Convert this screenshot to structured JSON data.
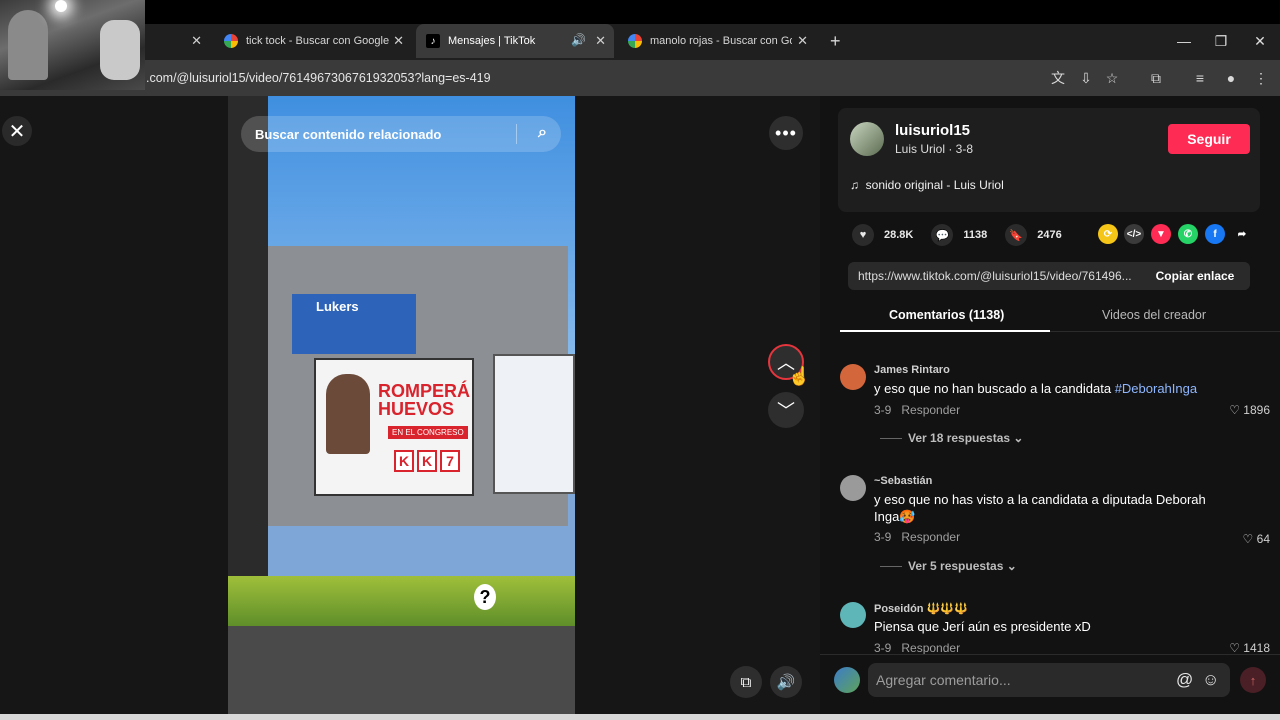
{
  "browser": {
    "tabs": [
      {
        "label": "",
        "icon": "generic-tab"
      },
      {
        "label": "tick tock - Buscar con Google",
        "icon": "google-icon"
      },
      {
        "label": "Mensajes | TikTok",
        "icon": "tiktok-icon",
        "active": true
      },
      {
        "label": "manolo rojas - Buscar con Goo",
        "icon": "google-icon"
      }
    ],
    "new_tab": "+",
    "url": ".com/@luisuriol15/video/7614967306761932053?lang=es-419",
    "window": {
      "minimize": "—",
      "maximize": "❐",
      "close": "✕"
    }
  },
  "video": {
    "search_placeholder": "Buscar contenido relacionado",
    "billboard_text": "ROMPERÁ HUEVOS",
    "billboard_sub": "EN EL CONGRESO",
    "billboard_boxes": [
      "K",
      "K",
      "7"
    ],
    "store_sign": "Lukers",
    "question_mark": "?"
  },
  "controls": {
    "close": "✕",
    "more": "•••",
    "up": "︿",
    "down": "﹀"
  },
  "author": {
    "username": "luisuriol15",
    "display": "Luis Uriol · 3-8",
    "follow_label": "Seguir",
    "sound": "sonido original - Luis Uriol"
  },
  "stats": {
    "likes": "28.8K",
    "comments": "1138",
    "saves": "2476"
  },
  "share_colors": {
    "repost": "#f5c518",
    "embed": "#3a3a3a",
    "message": "#fe2c55",
    "whatsapp": "#25d366",
    "facebook": "#1877f2"
  },
  "link": {
    "url": "https://www.tiktok.com/@luisuriol15/video/761496...",
    "copy_label": "Copiar enlace"
  },
  "tabs": {
    "comments": "Comentarios (1138)",
    "creator": "Videos del creador"
  },
  "comments": [
    {
      "user": "James Rintaro",
      "text": "y eso que no han buscado a la candidata ",
      "tag": "#DeborahInga",
      "date": "3-9",
      "reply": "Responder",
      "likes": "1896",
      "more": "Ver 18 respuestas"
    },
    {
      "user": "~Sebastián",
      "text": "y eso que no has visto a la candidata a diputada Deborah Inga🥵",
      "date": "3-9",
      "reply": "Responder",
      "likes": "64",
      "more": "Ver 5 respuestas"
    },
    {
      "user": "Poseidón 🔱🔱🔱",
      "text": "Piensa que Jerí aún es presidente xD",
      "date": "3-9",
      "reply": "Responder",
      "likes": "1418"
    }
  ],
  "compose": {
    "placeholder": "Agregar comentario..."
  }
}
